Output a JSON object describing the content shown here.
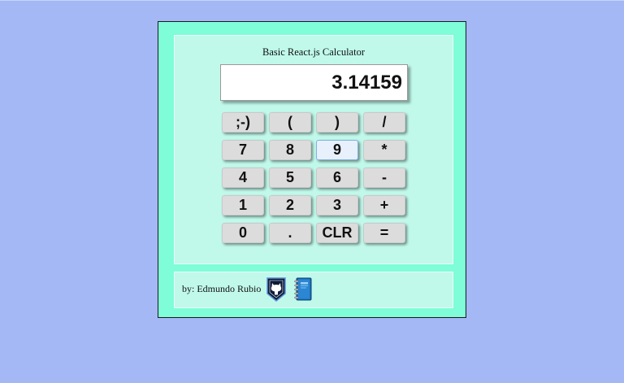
{
  "app": {
    "title": "Basic React.js Calculator"
  },
  "display": {
    "value": "3.14159"
  },
  "keys": {
    "row1": [
      ";-)",
      "(",
      ")",
      "/"
    ],
    "row2": [
      "7",
      "8",
      "9",
      "*"
    ],
    "row3": [
      "4",
      "5",
      "6",
      "-"
    ],
    "row4": [
      "1",
      "2",
      "3",
      "+"
    ],
    "row5": [
      "0",
      ".",
      "CLR",
      "="
    ]
  },
  "credits": {
    "text": "by: Edmundo Rubio",
    "icons": [
      "github-icon",
      "notebook-icon"
    ]
  },
  "colors": {
    "background": "#a3b8f5",
    "frame": "#7ffcd8",
    "panel": "#c0f9ea",
    "key": "#dcdcdc"
  }
}
